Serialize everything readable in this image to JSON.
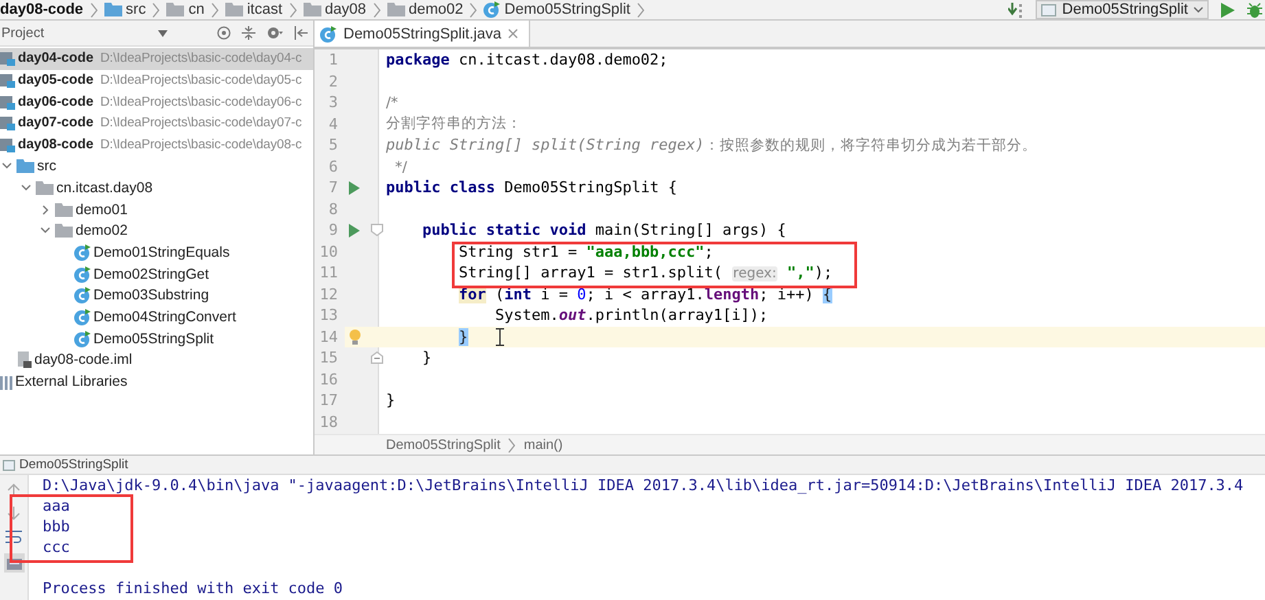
{
  "navbar": {
    "crumbs": [
      {
        "label": "day08-code"
      },
      {
        "label": "src",
        "kind": "source"
      },
      {
        "label": "cn",
        "kind": "folder"
      },
      {
        "label": "itcast",
        "kind": "folder"
      },
      {
        "label": "day08",
        "kind": "folder"
      },
      {
        "label": "demo02",
        "kind": "folder"
      },
      {
        "label": "Demo05StringSplit",
        "kind": "class"
      }
    ],
    "run_config": "Demo05StringSplit"
  },
  "project": {
    "title": "Project",
    "tree": [
      {
        "label": "day04-code",
        "path": "D:\\IdeaProjects\\basic-code\\day04-c",
        "kind": "module",
        "selected": true
      },
      {
        "label": "day05-code",
        "path": "D:\\IdeaProjects\\basic-code\\day05-c",
        "kind": "module",
        "selected": false
      },
      {
        "label": "day06-code",
        "path": "D:\\IdeaProjects\\basic-code\\day06-c",
        "kind": "module",
        "selected": false
      },
      {
        "label": "day07-code",
        "path": "D:\\IdeaProjects\\basic-code\\day07-c",
        "kind": "module",
        "selected": false
      },
      {
        "label": "day08-code",
        "path": "D:\\IdeaProjects\\basic-code\\day08-c",
        "kind": "module",
        "selected": false,
        "children": [
          {
            "label": "src",
            "kind": "source",
            "expanded": true,
            "selected": false,
            "children": [
              {
                "label": "cn.itcast.day08",
                "kind": "folder",
                "expanded": true,
                "selected": false,
                "children": [
                  {
                    "label": "demo01",
                    "kind": "folder",
                    "expanded": false,
                    "selected": false
                  },
                  {
                    "label": "demo02",
                    "kind": "folder",
                    "expanded": true,
                    "selected": false,
                    "children": [
                      {
                        "label": "Demo01StringEquals",
                        "kind": "class",
                        "selected": false
                      },
                      {
                        "label": "Demo02StringGet",
                        "kind": "class",
                        "selected": false
                      },
                      {
                        "label": "Demo03Substring",
                        "kind": "class",
                        "selected": false
                      },
                      {
                        "label": "Demo04StringConvert",
                        "kind": "class",
                        "selected": false
                      },
                      {
                        "label": "Demo05StringSplit",
                        "kind": "class",
                        "selected": false
                      }
                    ]
                  }
                ]
              }
            ]
          },
          {
            "label": "day08-code.iml",
            "kind": "file",
            "selected": false
          }
        ]
      },
      {
        "label": "External Libraries",
        "kind": "library",
        "selected": false
      }
    ]
  },
  "editor": {
    "tabs": [
      {
        "label": "Demo05StringSplit.java",
        "selected": true
      }
    ],
    "lines": [
      {
        "number": "1",
        "tokens": [
          {
            "kind": "kw",
            "text": "package"
          },
          {
            "kind": "plain",
            "text": " cn.itcast.day08.demo02;"
          }
        ]
      },
      {
        "number": "2"
      },
      {
        "number": "3",
        "tokens": [
          {
            "kind": "cmt",
            "text": "/*"
          }
        ]
      },
      {
        "number": "4",
        "tokens": [
          {
            "kind": "cmt",
            "text": "分割字符串的方法："
          }
        ]
      },
      {
        "number": "5",
        "tokens": [
          {
            "kind": "cmt-i",
            "text": "public String[] split(String regex)"
          },
          {
            "kind": "cmt",
            "text": "：按照参数的规则，将字符串切分成为若干部分。"
          }
        ]
      },
      {
        "number": "6",
        "tokens": [
          {
            "kind": "cmt",
            "text": " */"
          }
        ]
      },
      {
        "number": "7",
        "runnable": true,
        "tokens": [
          {
            "kind": "kw",
            "text": "public class"
          },
          {
            "kind": "plain",
            "text": " Demo05StringSplit {"
          }
        ]
      },
      {
        "number": "8"
      },
      {
        "number": "9",
        "runnable": true,
        "fold_start": true,
        "tokens": [
          {
            "kind": "kw",
            "text": "    public static void"
          },
          {
            "kind": "plain",
            "text": " main(String[] args) {"
          }
        ]
      },
      {
        "number": "10",
        "boxed": true,
        "tokens": [
          {
            "kind": "plain",
            "text": "        String str1 = "
          },
          {
            "kind": "str",
            "text": "\"aaa,bbb,ccc\""
          },
          {
            "kind": "plain",
            "text": ";"
          }
        ]
      },
      {
        "number": "11",
        "boxed": true,
        "tokens": [
          {
            "kind": "plain",
            "text": "        String[] array1 = str1.split( "
          },
          {
            "kind": "hint",
            "text": "regex:"
          },
          {
            "kind": "str",
            "text": " \",\""
          },
          {
            "kind": "plain",
            "text": ");"
          }
        ]
      },
      {
        "number": "12",
        "tokens": [
          {
            "kind": "kw-mark",
            "text": "        for"
          },
          {
            "kind": "plain",
            "text": " ("
          },
          {
            "kind": "kw",
            "text": "int"
          },
          {
            "kind": "plain",
            "text": " i = "
          },
          {
            "kind": "num",
            "text": "0"
          },
          {
            "kind": "plain",
            "text": "; i < array1."
          },
          {
            "kind": "field",
            "text": "length"
          },
          {
            "kind": "plain",
            "text": "; i++) "
          },
          {
            "kind": "brace",
            "text": "{"
          }
        ]
      },
      {
        "number": "13",
        "tokens": [
          {
            "kind": "plain",
            "text": "            System."
          },
          {
            "kind": "static",
            "text": "out"
          },
          {
            "kind": "plain",
            "text": ".println(array1[i]);"
          }
        ]
      },
      {
        "number": "14",
        "intention": true,
        "current": true,
        "mouse_cursor": true,
        "tokens": [
          {
            "kind": "brace",
            "text": "        }"
          }
        ]
      },
      {
        "number": "15",
        "fold_end": true,
        "tokens": [
          {
            "kind": "plain",
            "text": "    }"
          }
        ]
      },
      {
        "number": "16"
      },
      {
        "number": "17",
        "tokens": [
          {
            "kind": "plain",
            "text": "}"
          }
        ]
      },
      {
        "number": "18"
      }
    ],
    "breadcrumbs": [
      "Demo05StringSplit",
      "main()"
    ]
  },
  "run_panel": {
    "title": "Demo05StringSplit",
    "output": [
      {
        "text": "D:\\Java\\jdk-9.0.4\\bin\\java \"-javaagent:D:\\JetBrains\\IntelliJ IDEA 2017.3.4\\lib\\idea_rt.jar=50914:D:\\JetBrains\\IntelliJ IDEA 2017.3.4"
      },
      {
        "text": "aaa",
        "boxed": true
      },
      {
        "text": "bbb",
        "boxed": true
      },
      {
        "text": "ccc",
        "boxed": true
      },
      {
        "text": "Process finished with exit code 0",
        "gap_before": true
      }
    ]
  }
}
